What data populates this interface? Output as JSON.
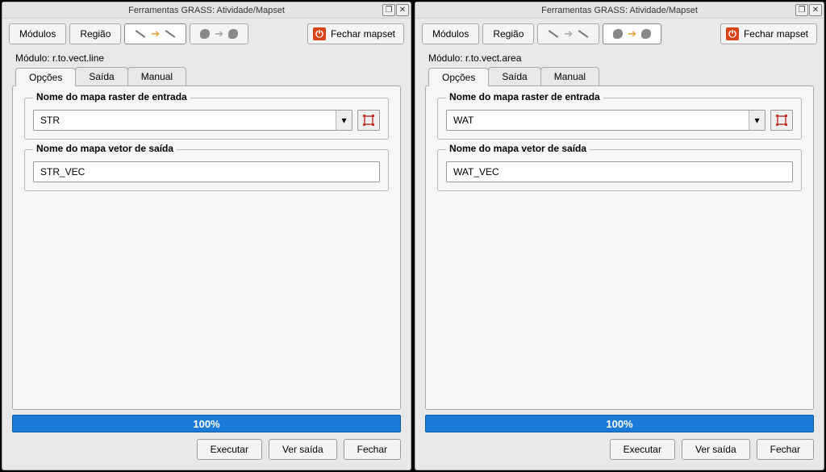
{
  "windows": [
    {
      "title": "Ferramentas GRASS: Atividade/Mapset",
      "tabs": {
        "modulos": "Módulos",
        "regiao": "Região"
      },
      "close_mapset": "Fechar mapset",
      "module_prefix": "Módulo: ",
      "module": "r.to.vect.line",
      "subtabs": {
        "opcoes": "Opções",
        "saida": "Saída",
        "manual": "Manual"
      },
      "legend_input": "Nome do mapa raster de entrada",
      "input_value": "STR",
      "legend_output": "Nome do mapa vetor de saída",
      "output_value": "STR_VEC",
      "progress": "100%",
      "buttons": {
        "run": "Executar",
        "view": "Ver saída",
        "close": "Fechar"
      }
    },
    {
      "title": "Ferramentas GRASS: Atividade/Mapset",
      "tabs": {
        "modulos": "Módulos",
        "regiao": "Região"
      },
      "close_mapset": "Fechar mapset",
      "module_prefix": "Módulo: ",
      "module": "r.to.vect.area",
      "subtabs": {
        "opcoes": "Opções",
        "saida": "Saída",
        "manual": "Manual"
      },
      "legend_input": "Nome do mapa raster de entrada",
      "input_value": "WAT",
      "legend_output": "Nome do mapa vetor de saída",
      "output_value": "WAT_VEC",
      "progress": "100%",
      "buttons": {
        "run": "Executar",
        "view": "Ver saída",
        "close": "Fechar"
      }
    }
  ]
}
